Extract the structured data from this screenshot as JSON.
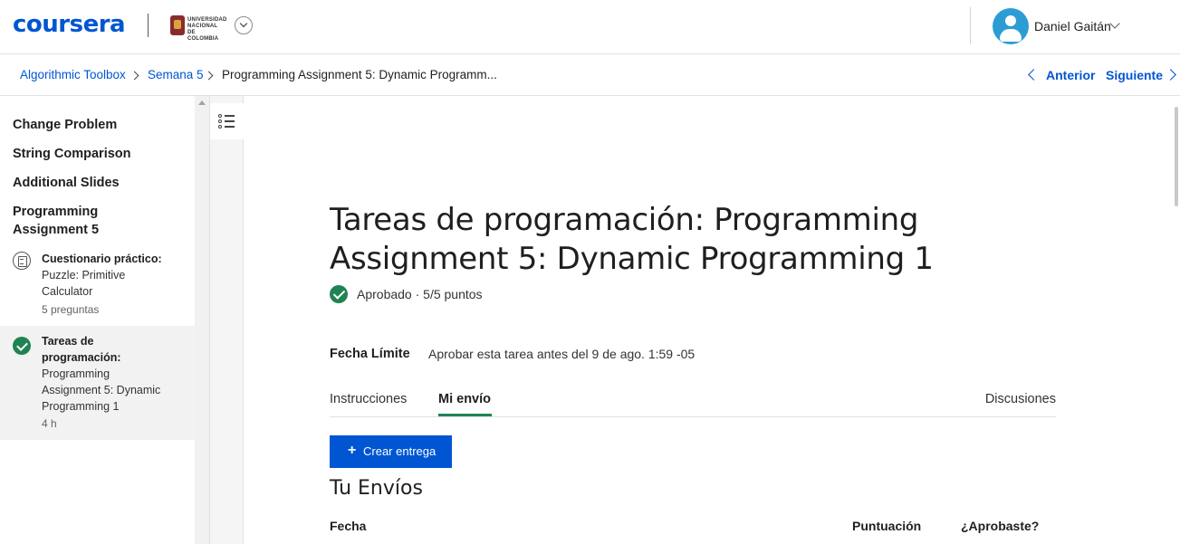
{
  "header": {
    "logo": "coursera",
    "university_text": "UNIVERSIDAD NACIONAL DE COLOMBIA",
    "user_name": "Daniel Gaitán"
  },
  "breadcrumb": {
    "items": [
      "Algorithmic Toolbox",
      "Semana 5",
      "Programming Assignment 5: Dynamic Programm..."
    ],
    "prev_label": "Anterior",
    "next_label": "Siguiente"
  },
  "sidebar": {
    "sections": [
      "Change Problem",
      "String Comparison",
      "Additional Slides",
      "Programming Assignment 5"
    ],
    "items": [
      {
        "type": "Cuestionario práctico:",
        "title": "Puzzle: Primitive Calculator",
        "meta": "5 preguntas",
        "icon": "quiz-icon"
      },
      {
        "type": "Tareas de programación:",
        "title": "Programming Assignment 5: Dynamic Programming 1",
        "meta": "4 h",
        "icon": "check-circle-icon"
      }
    ]
  },
  "main": {
    "title": "Tareas de programación: Programming Assignment 5: Dynamic Programming 1",
    "status": "Aprobado · 5/5 puntos",
    "due_label": "Fecha Límite",
    "due_value": "Aprobar esta tarea antes del 9 de ago. 1:59 -05",
    "tabs": [
      "Instrucciones",
      "Mi envío",
      "Discusiones"
    ],
    "active_tab": "Mi envío",
    "create_button": "Crear entrega",
    "submissions_title": "Tu Envíos",
    "table_headers": [
      "Fecha",
      "Puntuación",
      "¿Aprobaste?"
    ]
  },
  "colors": {
    "brand": "#0056d2",
    "success": "#1f8354",
    "avatar": "#2b9dd4"
  }
}
